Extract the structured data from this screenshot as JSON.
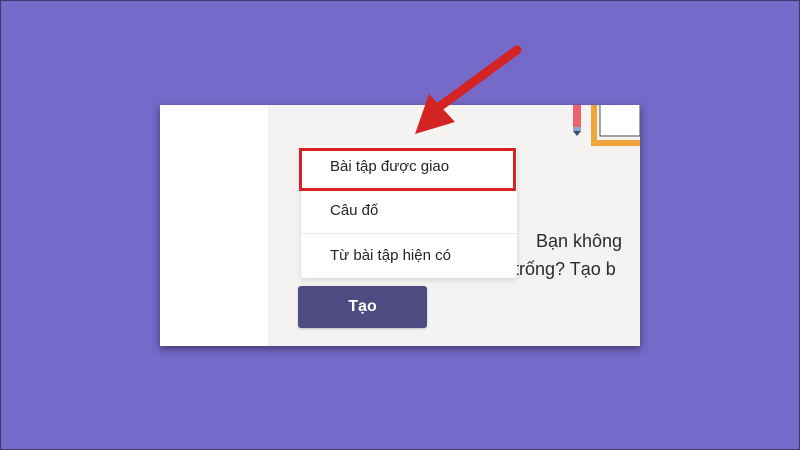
{
  "menu": {
    "items": [
      {
        "label": "Bài tập được giao"
      },
      {
        "label": "Câu đố"
      },
      {
        "label": "Từ bài tập hiện có"
      }
    ]
  },
  "create_button": {
    "label": "Tạo"
  },
  "empty_state": {
    "line1": "Bạn không",
    "line2": "trống? Tạo b"
  },
  "colors": {
    "background": "#7569c9",
    "button": "#4e4b82",
    "highlight": "#d42323"
  }
}
